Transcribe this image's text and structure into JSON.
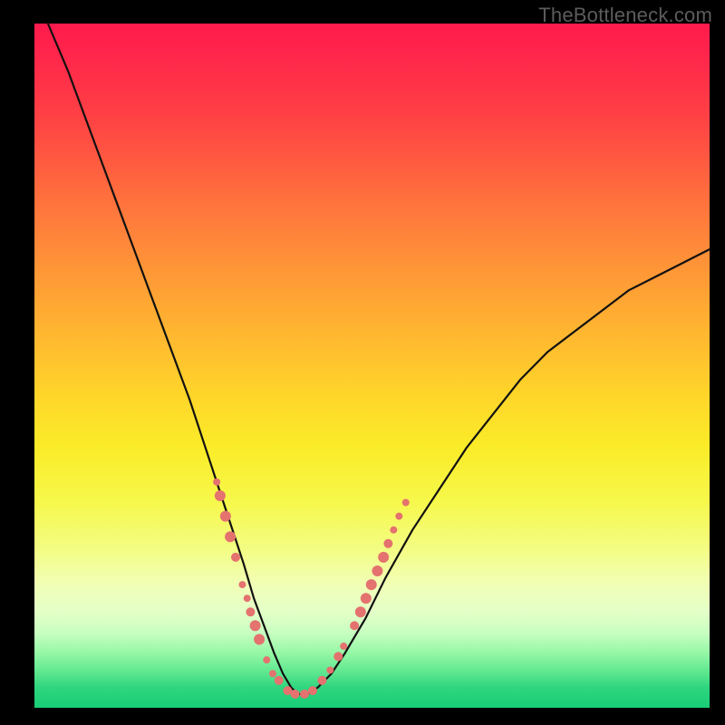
{
  "watermark": "TheBottleneck.com",
  "chart_data": {
    "type": "line",
    "title": "",
    "xlabel": "",
    "ylabel": "",
    "xlim": [
      0,
      100
    ],
    "ylim": [
      0,
      100
    ],
    "grid": false,
    "legend": false,
    "background": "rainbow-gradient-vertical",
    "note": "Axes unlabeled in source image; x and y are normalized 0–100 from the plot area. Curve is a V-shaped bottleneck curve; markers are salmon dots clustered along the curve near its minimum.",
    "series": [
      {
        "name": "bottleneck-curve",
        "x": [
          2,
          5,
          8,
          11,
          14,
          17,
          20,
          23,
          25,
          27,
          29,
          31,
          32.5,
          34,
          35.5,
          36.8,
          38,
          39,
          40.5,
          42,
          44,
          46,
          49,
          52,
          56,
          60,
          64,
          68,
          72,
          76,
          80,
          84,
          88,
          92,
          96,
          100
        ],
        "y": [
          100,
          93,
          85,
          77,
          69,
          61,
          53,
          45,
          39,
          33,
          27,
          21,
          16,
          12,
          8,
          5,
          3,
          2,
          2,
          3,
          5,
          8,
          13,
          19,
          26,
          32,
          38,
          43,
          48,
          52,
          55,
          58,
          61,
          63,
          65,
          67
        ]
      }
    ],
    "markers": {
      "name": "highlighted-points",
      "color": "#e4726f",
      "points": [
        {
          "x": 27.0,
          "y": 33,
          "r": 4
        },
        {
          "x": 27.5,
          "y": 31,
          "r": 6
        },
        {
          "x": 28.3,
          "y": 28,
          "r": 6
        },
        {
          "x": 29.0,
          "y": 25,
          "r": 6
        },
        {
          "x": 29.8,
          "y": 22,
          "r": 5
        },
        {
          "x": 30.8,
          "y": 18,
          "r": 4
        },
        {
          "x": 31.5,
          "y": 16,
          "r": 4
        },
        {
          "x": 32.0,
          "y": 14,
          "r": 5
        },
        {
          "x": 32.7,
          "y": 12,
          "r": 6
        },
        {
          "x": 33.3,
          "y": 10,
          "r": 6
        },
        {
          "x": 34.4,
          "y": 7,
          "r": 4
        },
        {
          "x": 35.3,
          "y": 5,
          "r": 4
        },
        {
          "x": 36.2,
          "y": 4,
          "r": 5
        },
        {
          "x": 37.5,
          "y": 2.5,
          "r": 5
        },
        {
          "x": 38.6,
          "y": 2,
          "r": 5
        },
        {
          "x": 40.0,
          "y": 2,
          "r": 5
        },
        {
          "x": 41.2,
          "y": 2.5,
          "r": 5
        },
        {
          "x": 42.6,
          "y": 4,
          "r": 5
        },
        {
          "x": 43.8,
          "y": 5.5,
          "r": 4
        },
        {
          "x": 45.0,
          "y": 7.5,
          "r": 5
        },
        {
          "x": 45.8,
          "y": 9,
          "r": 4
        },
        {
          "x": 47.4,
          "y": 12,
          "r": 5
        },
        {
          "x": 48.3,
          "y": 14,
          "r": 6
        },
        {
          "x": 49.1,
          "y": 16,
          "r": 6
        },
        {
          "x": 49.9,
          "y": 18,
          "r": 6
        },
        {
          "x": 50.8,
          "y": 20,
          "r": 6
        },
        {
          "x": 51.7,
          "y": 22,
          "r": 6
        },
        {
          "x": 52.4,
          "y": 24,
          "r": 5
        },
        {
          "x": 53.2,
          "y": 26,
          "r": 4
        },
        {
          "x": 54.0,
          "y": 28,
          "r": 4
        },
        {
          "x": 55.0,
          "y": 30,
          "r": 4
        }
      ]
    }
  }
}
